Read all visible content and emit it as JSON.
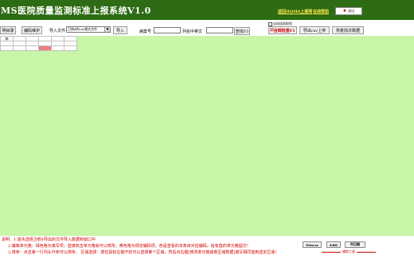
{
  "app": {
    "title": "MS医院质量监测标准上报系统V1.0",
    "links": [
      "返回HQMS上报网",
      "在线帮助"
    ],
    "exit_label": "退出"
  },
  "toolbar": {
    "left_tab": "明目录",
    "encode_label": "编码维护",
    "import_label": "导入文件",
    "format_select": "卫统4的csv格式文件",
    "import_button": "导入",
    "case_no_label": "病案号",
    "column_label": "列名中英文",
    "case_no_value": "",
    "column_value": "",
    "find_label": "查找F3",
    "checkbox_label": "自动连续校验",
    "validate_label": "合规检查F1",
    "export_label": "导出csv上传",
    "restore_label": "恢复前次数据"
  },
  "grid": {
    "header": "病",
    "accent": "#f08080"
  },
  "footer": {
    "line1": "说明：1.首先选择卫统4导出的文件导入数据到窗口中",
    "line2": "2.编辑单元格：绿色格为填写项，直接双击单元格就可以修改，黄色格为规定编码项，色是查看的本条目对应编码，给有值的单元格提交！",
    "line3": "3.排序：点击第一行列头升序可以排序。   区域选择：按住鼠标左键不松可以选择某个区域，然后点右键[修改单元格或者区域数据]填写相同值到选定区域！",
    "buttons": [
      "Wincar",
      "KBR",
      "列日期"
    ],
    "assist_label": "辅助工具"
  },
  "colors": {
    "title_bg": "#2d6b14",
    "content_bg": "#c8f5a8",
    "link": "#ffe94a",
    "info": "#d40000"
  }
}
